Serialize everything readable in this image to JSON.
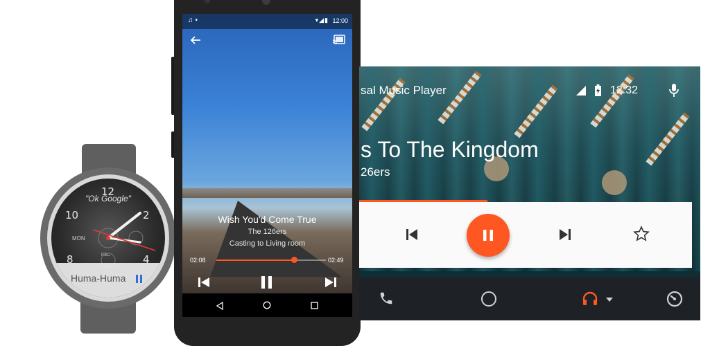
{
  "watch": {
    "hint": "\"Ok Google\"",
    "numerals": {
      "n12": "12",
      "n2": "2",
      "n4": "4",
      "n10": "10",
      "n8": "8"
    },
    "day": "MON",
    "date": "DEC",
    "card": {
      "title": "Huma-Huma"
    }
  },
  "phone": {
    "status": {
      "time": "12:00"
    },
    "track": {
      "title": "Wish You'd Come True",
      "artist": "The 126ers",
      "cast_status": "Casting to Living room"
    },
    "progress": {
      "elapsed": "02:08",
      "duration": "02:49",
      "fraction": 0.73
    }
  },
  "car": {
    "app_title": "sal Music Player",
    "status": {
      "time": "12:32"
    },
    "track": {
      "title": "s To The Kingdom",
      "artist": "26ers"
    },
    "progress_fraction": 0.38,
    "accent": "#ff5722"
  },
  "icons": {
    "back": "arrow-back-icon",
    "cast": "cast-icon",
    "mic": "mic-icon",
    "phone": "phone-icon",
    "home": "circle-home-icon",
    "headphones": "headphones-icon",
    "speedometer": "speedometer-icon"
  }
}
